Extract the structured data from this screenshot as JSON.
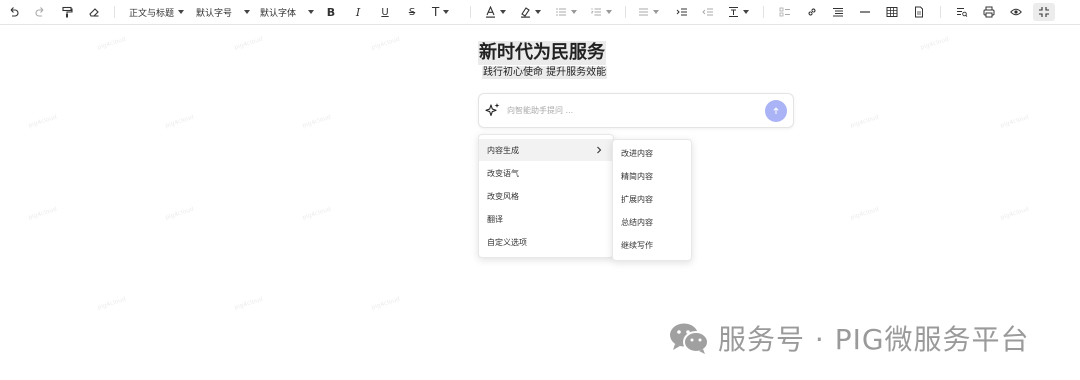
{
  "toolbar": {
    "paragraph_select": "正文与标题",
    "font_size_select": "默认字号",
    "font_family_select": "默认字体",
    "bold": "B",
    "italic": "I",
    "underline": "U",
    "strike": "S",
    "text_style": "T"
  },
  "document": {
    "title": "新时代为民服务",
    "subtitle": "践行初心使命 提升服务效能"
  },
  "ai_assistant": {
    "placeholder": "向智能助手提问 ...",
    "send_color": "#a9b3f5"
  },
  "menu": {
    "items": [
      {
        "label": "内容生成",
        "has_submenu": true
      },
      {
        "label": "改变语气"
      },
      {
        "label": "改变风格"
      },
      {
        "label": "翻译"
      },
      {
        "label": "自定义选项"
      }
    ]
  },
  "submenu": {
    "items": [
      {
        "label": "改进内容"
      },
      {
        "label": "精简内容"
      },
      {
        "label": "扩展内容"
      },
      {
        "label": "总结内容"
      },
      {
        "label": "继续写作"
      }
    ]
  },
  "footer": {
    "watermark_text": "服务号 · PIG微服务平台"
  },
  "background_watermark": "pig4cloud"
}
